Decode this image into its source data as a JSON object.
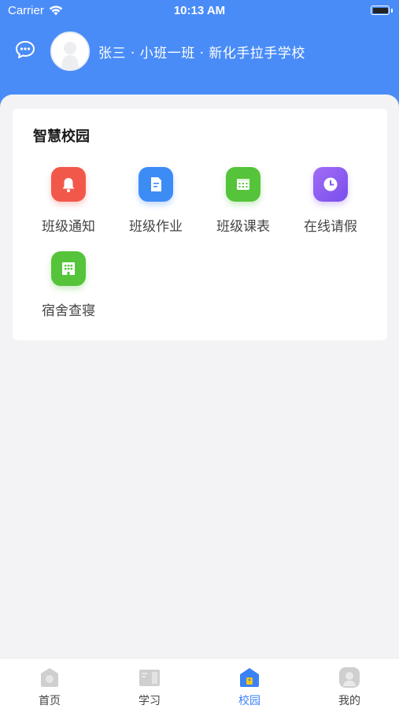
{
  "status_bar": {
    "carrier": "Carrier",
    "time": "10:13 AM",
    "icons": [
      "wifi-icon",
      "battery-icon"
    ]
  },
  "profile": {
    "text": "张三 · 小班一班 · 新化手拉手学校",
    "icons": [
      "chat-icon",
      "avatar"
    ]
  },
  "campus": {
    "title": "智慧校园",
    "items": [
      {
        "label": "班级通知",
        "icon": "bell-icon",
        "color": "#f2584a"
      },
      {
        "label": "班级作业",
        "icon": "document-icon",
        "color": "#3d8bf5"
      },
      {
        "label": "班级课表",
        "icon": "calendar-icon",
        "color": "#55c43a"
      },
      {
        "label": "在线请假",
        "icon": "clock-icon",
        "color": "#8a5af0"
      },
      {
        "label": "宿舍查寝",
        "icon": "building-icon",
        "color": "#55c43a"
      }
    ]
  },
  "tabbar": {
    "tabs": [
      {
        "label": "首页",
        "icon": "home-icon",
        "active": false
      },
      {
        "label": "学习",
        "icon": "study-icon",
        "active": false
      },
      {
        "label": "校园",
        "icon": "campus-icon",
        "active": true
      },
      {
        "label": "我的",
        "icon": "profile-icon",
        "active": false
      }
    ]
  },
  "colors": {
    "header": "#4a8cf7",
    "active_tab": "#3b82f6",
    "background": "#f3f3f5"
  }
}
